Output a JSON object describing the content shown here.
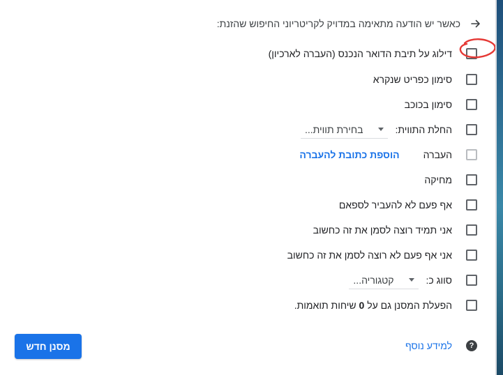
{
  "header": {
    "text": "כאשר יש הודעה מתאימה במדויק לקריטריוני החיפוש שהזנת:",
    "icon": "arrow-right-icon"
  },
  "options": [
    {
      "label": "דילוג על תיבת הדואר הנכנס (העברה לארכיון)",
      "checked": false
    },
    {
      "label": "סימון כפריט שנקרא",
      "checked": false
    },
    {
      "label": "סימון בכוכב",
      "checked": false
    },
    {
      "label": "החלת התווית:",
      "checked": false,
      "select_value": "בחירת תווית..."
    },
    {
      "label": "העברה",
      "checked": false,
      "disabled": true,
      "link": "הוספת כתובת להעברה"
    },
    {
      "label": "מחיקה",
      "checked": false
    },
    {
      "label": "אף פעם לא להעביר לספאם",
      "checked": false
    },
    {
      "label": "אני תמיד רוצה לסמן את זה כחשוב",
      "checked": false
    },
    {
      "label": "אני אף פעם לא רוצה לסמן את זה כחשוב",
      "checked": false
    },
    {
      "label": "סווג כ:",
      "checked": false,
      "select_value": "קטגוריה..."
    },
    {
      "label_prefix": "הפעלת המסנן גם על",
      "label_number": "0",
      "label_suffix": "שיחות תואמות.",
      "checked": false
    }
  ],
  "footer": {
    "help_icon": "help-circle-icon",
    "help_link": "למידע נוסף",
    "create_button": "מסנן חדש"
  },
  "colors": {
    "accent": "#1a73e8",
    "annotation": "#e53935"
  }
}
